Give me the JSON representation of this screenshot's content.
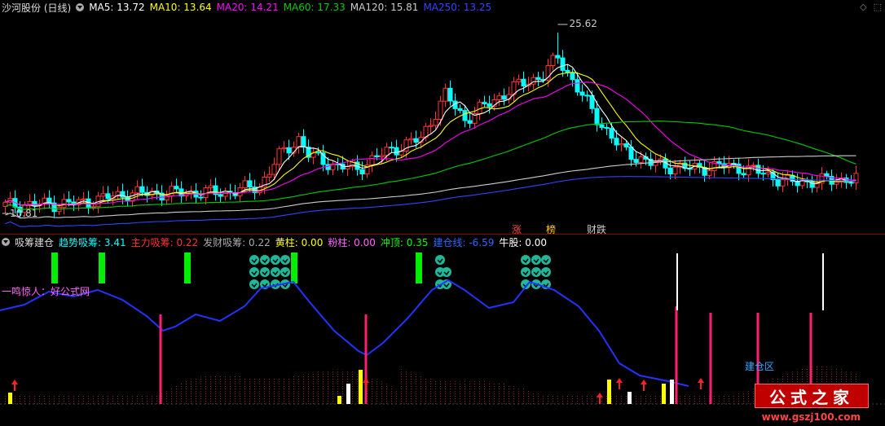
{
  "main": {
    "title": "沙河股份 (日线)",
    "ma_items": [
      {
        "label": "MA5: 13.72",
        "color": "#ffffff"
      },
      {
        "label": "MA10: 13.64",
        "color": "#ffff00"
      },
      {
        "label": "MA20: 14.21",
        "color": "#ff00ff"
      },
      {
        "label": "MA60: 17.33",
        "color": "#00cc00"
      },
      {
        "label": "MA120: 15.81",
        "color": "#cccccc"
      },
      {
        "label": "MA250: 13.25",
        "color": "#3344ff"
      }
    ],
    "high_label": "25.62",
    "low_label": "10.81",
    "badges": [
      {
        "label": "涨",
        "color": "#ff4444"
      },
      {
        "label": "榜",
        "color": "#ffcc00"
      },
      {
        "label": "财跌",
        "color": "#cccccc"
      }
    ]
  },
  "sub": {
    "title": "吸筹建仓",
    "items": [
      {
        "label": "趋势吸筹: 3.41",
        "color": "#00ffff"
      },
      {
        "label": "主力吸筹: 0.22",
        "color": "#ff3333"
      },
      {
        "label": "发财吸筹: 0.22",
        "color": "#aaaaaa"
      },
      {
        "label": "黄柱: 0.00",
        "color": "#ffff00"
      },
      {
        "label": "粉柱: 0.00",
        "color": "#ff66ff"
      },
      {
        "label": "冲顶: 0.35",
        "color": "#00ff00"
      },
      {
        "label": "建仓线: -6.59",
        "color": "#3366ff"
      },
      {
        "label": "牛股: 0.00",
        "color": "#ffffff"
      }
    ],
    "annotation_left": "一鸣惊人：好公式网",
    "annotation_right": "建仓区"
  },
  "watermarks": {
    "logo": "公式之家",
    "url": "www.gszj100.com"
  },
  "colors": {
    "up": "#ff3333",
    "down": "#00ffff",
    "ma5": "#ffffff",
    "ma10": "#ffff00",
    "ma20": "#ff00ff",
    "ma60": "#00cc00",
    "ma120": "#cccccc",
    "ma250": "#3344ff"
  }
}
